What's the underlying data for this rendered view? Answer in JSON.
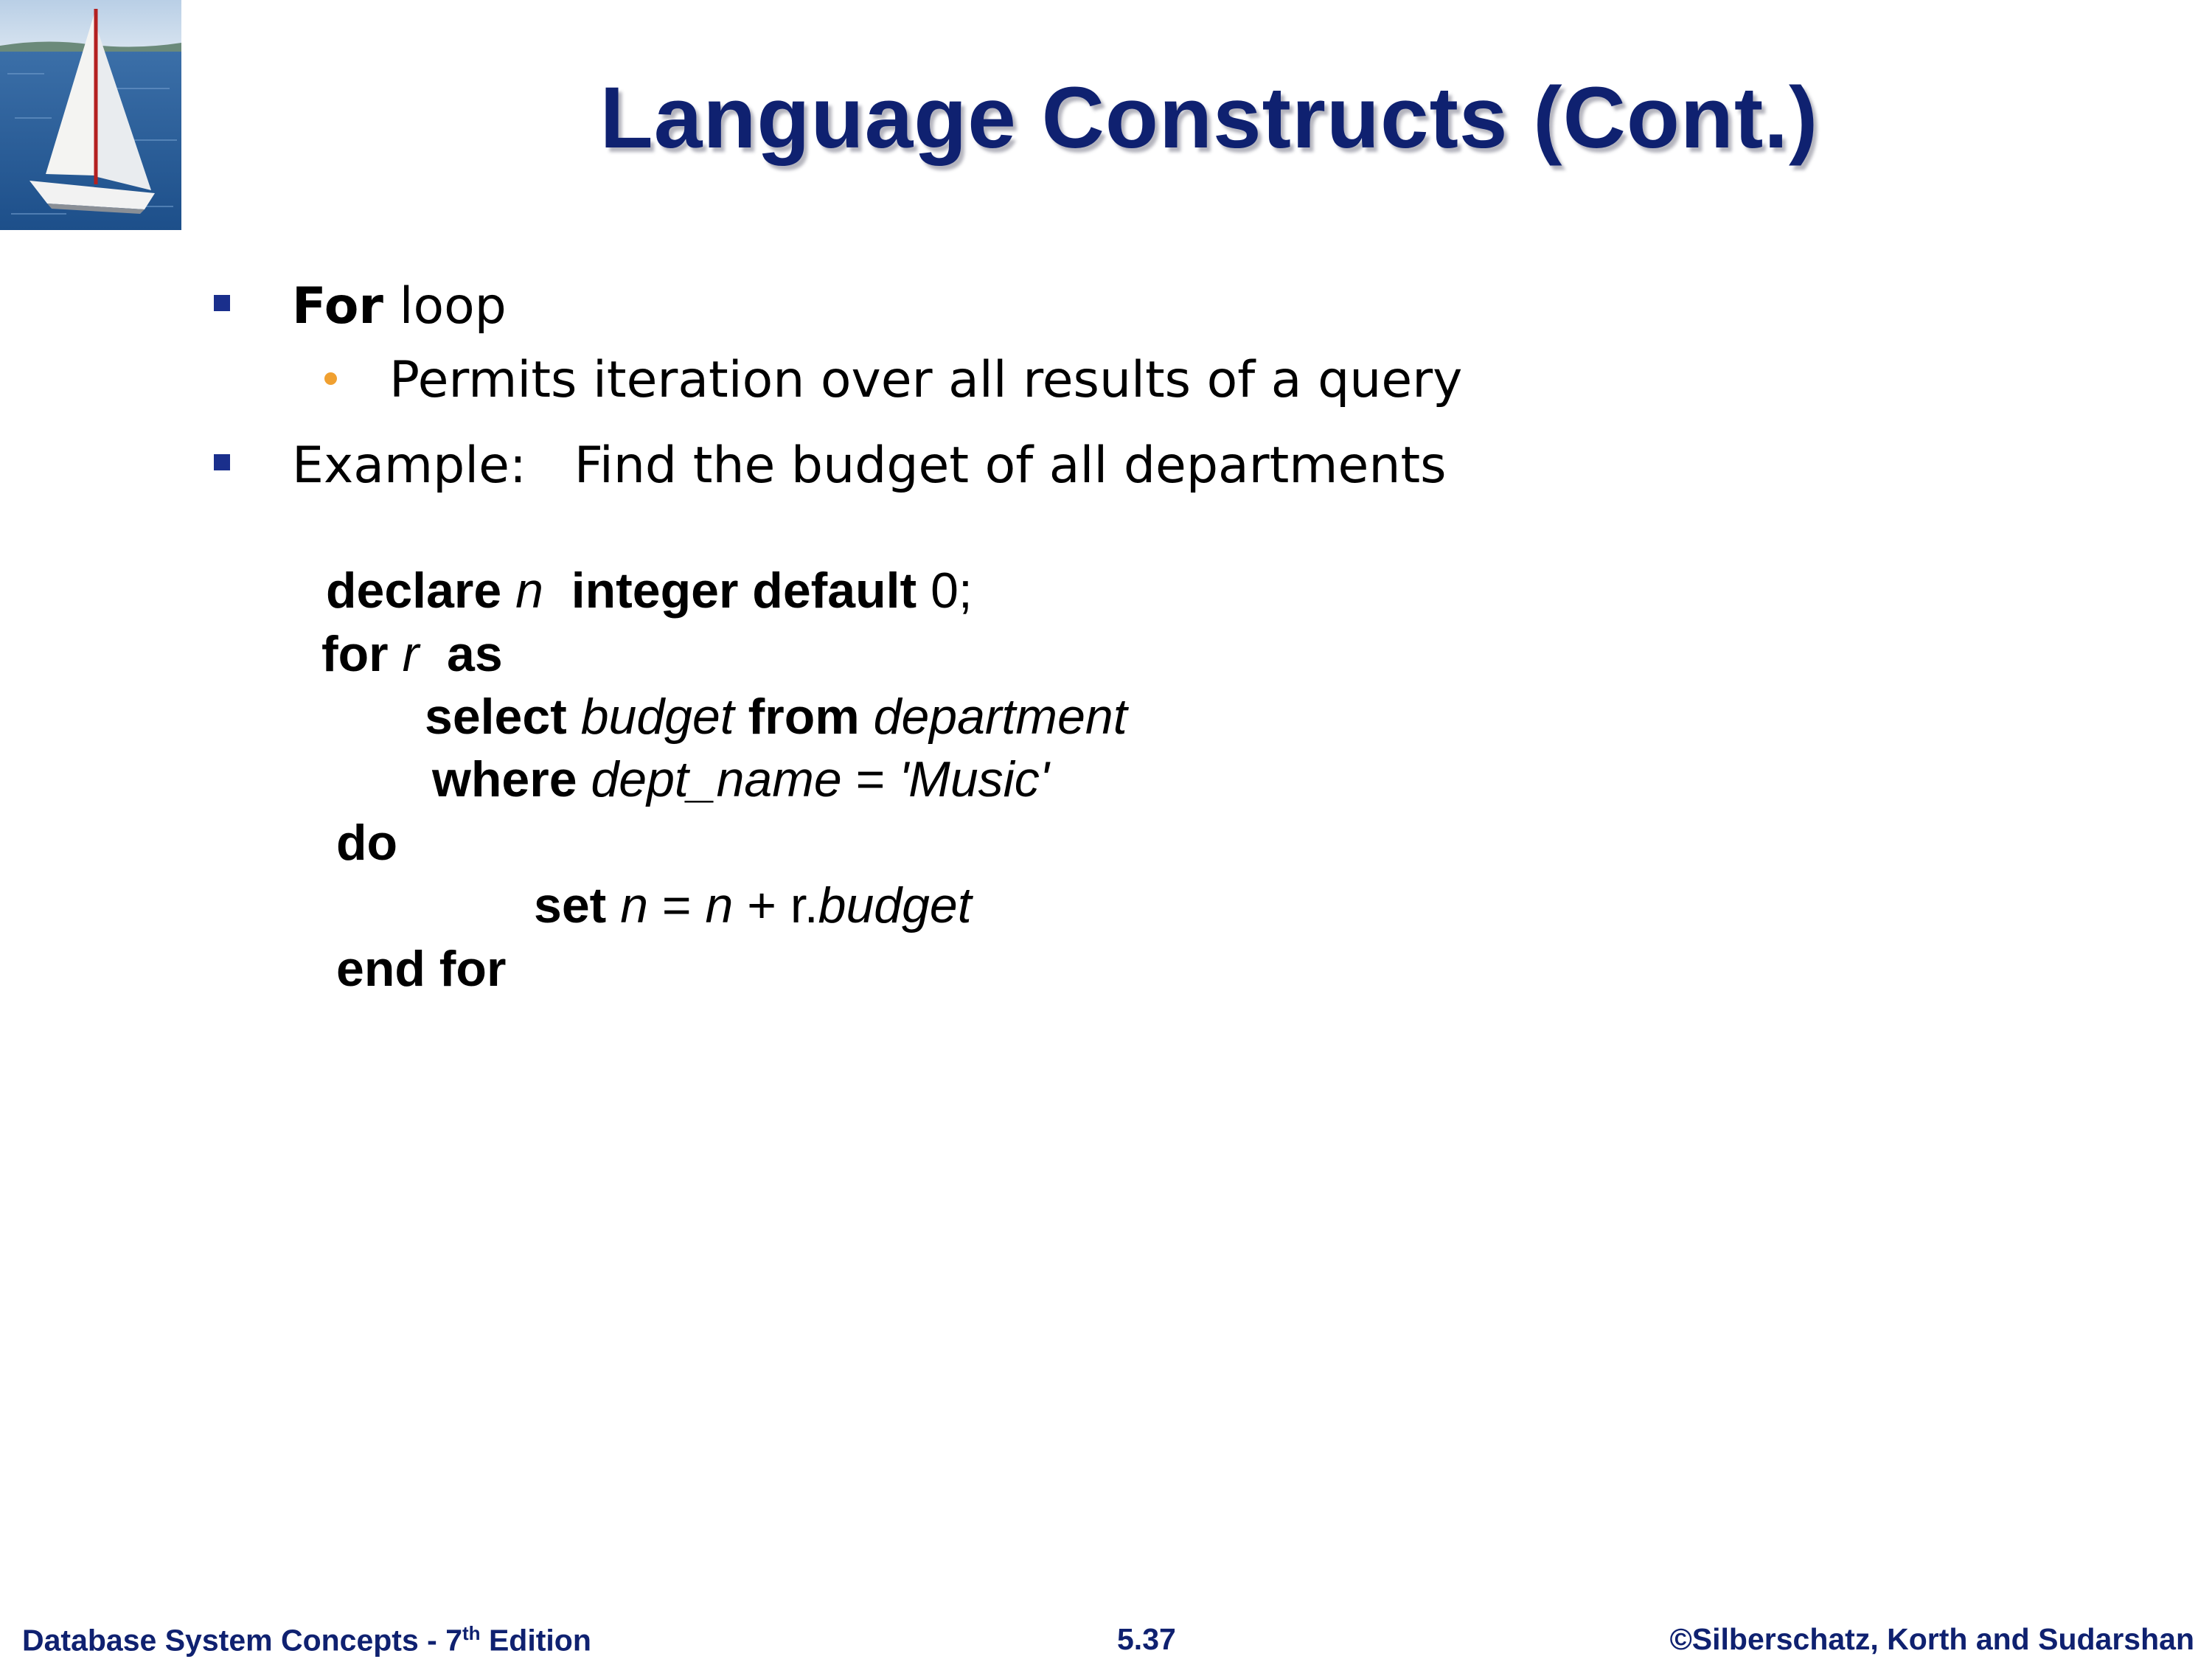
{
  "slide": {
    "title": "Language Constructs (Cont.)",
    "bullets": [
      {
        "label_bold": "For",
        "label_rest": " loop",
        "sub": [
          "Permits iteration over all results of a query"
        ]
      },
      {
        "label_bold": "",
        "label_rest": "Example:   Find the budget of all departments",
        "sub": []
      }
    ],
    "code": {
      "line1": {
        "kw1": "declare",
        "var": "n",
        "kw2": "integer default",
        "val": "0;"
      },
      "line2": {
        "kw1": "for",
        "var": "r",
        "kw2": "as"
      },
      "line3": {
        "kw1": "select",
        "attr": "budget",
        "kw2": "from",
        "rel": "department"
      },
      "line4": {
        "kw1": "where",
        "attr": "dept_name",
        "op": " = ",
        "lit": "'Music'"
      },
      "line5": {
        "kw1": "do"
      },
      "line6": {
        "kw1": "set",
        "lhs": "n",
        "op1": " = ",
        "rhs": "n",
        "op2": " + r.",
        "attr": "budget"
      },
      "line7": {
        "kw1": "end for"
      }
    }
  },
  "footer": {
    "left_prefix": "Database System Concepts - 7",
    "left_sup": "th",
    "left_suffix": " Edition",
    "center": "5.37",
    "right": "©Silberschatz, Korth and Sudarshan"
  },
  "colors": {
    "title": "#0f2170",
    "square_bullet": "#1a2f8c",
    "round_bullet": "#f0a030",
    "footer": "#0f2170"
  }
}
